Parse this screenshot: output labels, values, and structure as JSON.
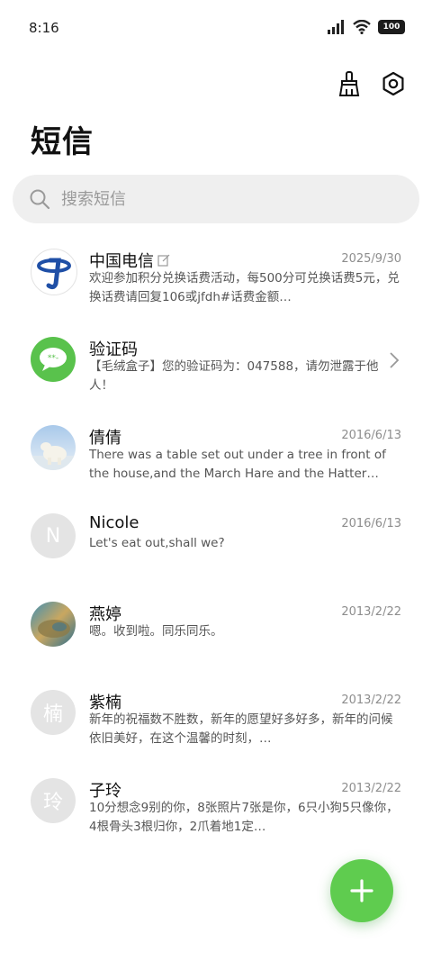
{
  "status": {
    "time": "8:16",
    "battery": "100"
  },
  "header": {
    "title": "短信"
  },
  "search": {
    "placeholder": "搜索短信"
  },
  "conversations": [
    {
      "name": "中国电信",
      "date": "2025/9/30",
      "preview": "欢迎参加积分兑换话费活动，每500分可兑换话费5元，兑换话费请回复106或jfdh#话费金额…",
      "avatar_type": "telecom-logo",
      "draft": true
    },
    {
      "name": "验证码",
      "date": "",
      "preview": "【毛绒盒子】您的验证码为：047588，请勿泄露于他人！",
      "avatar_type": "verification-bubble",
      "draft": false
    },
    {
      "name": "倩倩",
      "date": "2016/6/13",
      "preview": "There was a table set out under a tree in front of the house,and the March Hare and the Hatter were…",
      "avatar_type": "polar-bear-photo",
      "draft": false
    },
    {
      "name": "Nicole",
      "date": "2016/6/13",
      "preview": "Let's eat out,shall we?",
      "avatar_type": "letter",
      "avatar_letter": "N",
      "draft": false
    },
    {
      "name": "燕婷",
      "date": "2013/2/22",
      "preview": "嗯。收到啦。同乐同乐。",
      "avatar_type": "landscape-photo",
      "draft": false
    },
    {
      "name": "紫楠",
      "date": "2013/2/22",
      "preview": "新年的祝福数不胜数，新年的愿望好多好多，新年的问候依旧美好，在这个温馨的时刻，…",
      "avatar_type": "letter",
      "avatar_letter": "楠",
      "draft": false
    },
    {
      "name": "子玲",
      "date": "2013/2/22",
      "preview": "10分想念9别的你，8张照片7张是你，6只小狗5只像你，4根骨头3根归你，2爪着地1定…",
      "avatar_type": "letter",
      "avatar_letter": "玲",
      "draft": false
    }
  ],
  "colors": {
    "accent": "#5fcc4f",
    "search_bg": "#efefef",
    "date": "#8d8d8d"
  }
}
